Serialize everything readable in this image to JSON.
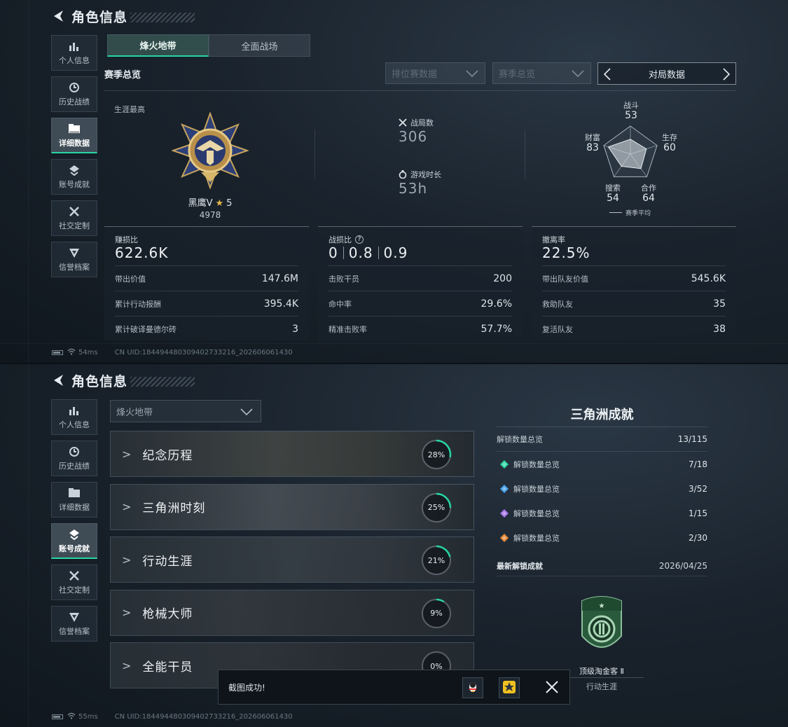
{
  "screen1": {
    "header": {
      "title": "角色信息"
    },
    "nav": [
      {
        "label": "个人信息",
        "icon": "bar-chart-icon"
      },
      {
        "label": "历史战绩",
        "icon": "clock-icon"
      },
      {
        "label": "详细数据",
        "icon": "folder-icon",
        "active": true
      },
      {
        "label": "账号成就",
        "icon": "medal-icon"
      },
      {
        "label": "社交定制",
        "icon": "tools-icon"
      },
      {
        "label": "信誉档案",
        "icon": "shield-icon"
      }
    ],
    "tabs": [
      {
        "label": "烽火地带",
        "active": true
      },
      {
        "label": "全面战场"
      }
    ],
    "season_label": "赛季总览",
    "filters": {
      "ranked": "排位赛数据",
      "season": "赛季总览",
      "match": "对局数据"
    },
    "career_label": "生涯最高",
    "rank": {
      "name": "黑鹰V",
      "stars": "5",
      "score": "4978"
    },
    "matches": {
      "label": "战局数",
      "value": "306"
    },
    "playtime": {
      "label": "游戏时长",
      "value": "53h"
    },
    "radar": {
      "axes": [
        {
          "label": "战斗",
          "value": 53
        },
        {
          "label": "生存",
          "value": 60
        },
        {
          "label": "合作",
          "value": 64
        },
        {
          "label": "搜索",
          "value": 54
        },
        {
          "label": "财富",
          "value": 83
        }
      ],
      "legend": "赛季平均"
    },
    "cards": [
      {
        "title": "赚损比",
        "value": "622.6K",
        "rows": [
          {
            "label": "带出价值",
            "value": "147.6M"
          },
          {
            "label": "累计行动报酬",
            "value": "395.4K"
          },
          {
            "label": "累计破译曼德尔砖",
            "value": "3"
          }
        ]
      },
      {
        "title": "战损比",
        "value_parts": [
          "0",
          "0.8",
          "0.9"
        ],
        "rows": [
          {
            "label": "击败干员",
            "value": "200"
          },
          {
            "label": "命中率",
            "value": "29.6%"
          },
          {
            "label": "精准击败率",
            "value": "57.7%"
          }
        ]
      },
      {
        "title": "撤离率",
        "value": "22.5%",
        "rows": [
          {
            "label": "带出队友价值",
            "value": "545.6K"
          },
          {
            "label": "救助队友",
            "value": "35"
          },
          {
            "label": "复活队友",
            "value": "38"
          }
        ]
      }
    ],
    "footer": {
      "ping": "54ms",
      "uid": "CN UID:18449448030940273321​6_202606061430"
    }
  },
  "screen2": {
    "header": {
      "title": "角色信息"
    },
    "nav": [
      {
        "label": "个人信息"
      },
      {
        "label": "历史战绩"
      },
      {
        "label": "详细数据"
      },
      {
        "label": "账号成就",
        "active": true
      },
      {
        "label": "社交定制"
      },
      {
        "label": "信誉档案"
      }
    ],
    "mode_select": "烽火地带",
    "achievements": [
      {
        "name": "纪念历程",
        "pct": "28%",
        "progress": 0.28
      },
      {
        "name": "三角洲时刻",
        "pct": "25%",
        "progress": 0.25
      },
      {
        "name": "行动生涯",
        "pct": "21%",
        "progress": 0.21
      },
      {
        "name": "枪械大师",
        "pct": "9%",
        "progress": 0.09
      },
      {
        "name": "全能干员",
        "pct": "0%",
        "progress": 0
      }
    ],
    "summary": {
      "title": "三角洲成就",
      "total_label": "解锁数量总览",
      "total_value": "13/115",
      "tiers": [
        {
          "label": "解锁数量总览",
          "value": "7/18",
          "color": "#2fd6a1"
        },
        {
          "label": "解锁数量总览",
          "value": "3/52",
          "color": "#4aa3e8"
        },
        {
          "label": "解锁数量总览",
          "value": "1/15",
          "color": "#a777e6"
        },
        {
          "label": "解锁数量总览",
          "value": "2/30",
          "color": "#e58a3a"
        }
      ],
      "latest_label": "最新解锁成就",
      "latest_date": "2026/04/25",
      "badge_name": "顶级淘金客 Ⅱ",
      "badge_category": "行动生涯"
    },
    "toast": {
      "text": "截图成功!"
    },
    "footer": {
      "ping": "55ms",
      "uid": "CN UID:184494480309402733216_202606061430"
    }
  }
}
